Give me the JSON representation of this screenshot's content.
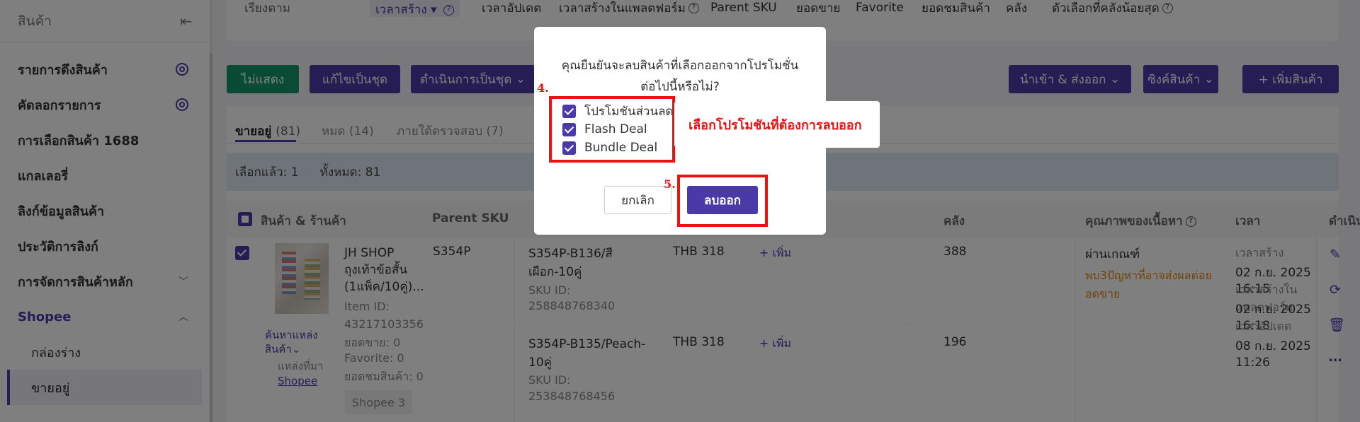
{
  "sidebar": {
    "title": "สินค้า",
    "items": [
      {
        "label": "รายการดึงสินค้า",
        "icon": "gear-icon"
      },
      {
        "label": "คัดลอกรายการ",
        "icon": "gear-icon"
      },
      {
        "label": "การเลือกสินค้า 1688"
      },
      {
        "label": "แกลเลอรี่"
      },
      {
        "label": "ลิงก์ข้อมูลสินค้า"
      },
      {
        "label": "ประวัติการลิงก์"
      },
      {
        "label": "การจัดการสินค้าหลัก",
        "icon": "chevron-down-icon"
      },
      {
        "label": "Shopee",
        "icon": "chevron-up-icon"
      }
    ],
    "subitems": [
      {
        "label": "กล่องร่าง"
      },
      {
        "label": "ขายอยู่"
      }
    ]
  },
  "filter": {
    "label": "เรียงตาม",
    "sort_options": [
      "เวลาสร้าง",
      "เวลาอัปเดต",
      "เวลาสร้างในแพลตฟอร์ม",
      "Parent SKU",
      "ยอดขาย",
      "Favorite",
      "ยอดชมสินค้า",
      "คลัง",
      "ตัวเลือกที่คลังน้อยสุด"
    ]
  },
  "toolbar": {
    "hide": "ไม่แสดง",
    "bulk_edit": "แก้ไขเป็นชุด",
    "bulk_action": "ดำเนินการเป็นชุด",
    "import_export": "นำเข้า & ส่งออก",
    "sync": "ซิงค์สินค้า",
    "add": "+ เพิ่มสินค้า"
  },
  "tabs": [
    {
      "label": "ขายอยู่",
      "count": "(81)"
    },
    {
      "label": "หมด",
      "count": "(14)"
    },
    {
      "label": "ภายใต้ตรวจสอบ",
      "count": "(7)"
    }
  ],
  "selection": {
    "selected": "เลือกแล้ว: 1",
    "total": "ทั้งหมด: 81"
  },
  "table": {
    "headers": [
      "สินค้า & ร้านค้า",
      "Parent SKU",
      "คลัง",
      "คุณภาพของเนื้อหา",
      "เวลา",
      "ดำเนิน"
    ],
    "product": {
      "shop": "JH SHOP",
      "name_line1": "ถุงเท้าข้อสั้น",
      "name_line2": "(1แพ็ค/10คู่)...",
      "item_id_label": "Item ID:",
      "item_id": "43217103356",
      "sales": "ยอดขาย: 0",
      "favorite": "Favorite: 0",
      "views": "ยอดชมสินค้า: 0",
      "find_source": "ค้นหาแหล่ง",
      "find_source2": "สินค้า",
      "source_label": "แหล่งที่มา",
      "source_link": "Shopee",
      "tag": "Shopee 3",
      "parent_sku": "S354P",
      "quality": "ผ่านเกณฑ์",
      "quality_warn1": "พบ3ปัญหาที่อาจส่งผลต่อย",
      "quality_warn2": "อดขาย",
      "time_created_label": "เวลาสร้าง",
      "time_created": "02 ก.ย. 2025 16:15",
      "time_platform_label": "เวลาสร้างในแพลตฟอร์ม",
      "time_platform": "02 ก.ย. 2025 16:18",
      "time_updated_label": "เวลาอัปเดต",
      "time_updated": "08 ก.ย. 2025 11:26"
    },
    "variants": [
      {
        "sku_line1": "S354P-B136/สี",
        "sku_line2": "เผือก-10คู่",
        "sku_id_label": "SKU ID:",
        "sku_id": "258848768340",
        "price": "THB 318",
        "add": "+ เพิ่ม",
        "stock": "388"
      },
      {
        "sku_line1": "S354P-B135/Peach-",
        "sku_line2": "10คู่",
        "sku_id_label": "SKU ID:",
        "sku_id": "253848768456",
        "price": "THB 318",
        "add": "+ เพิ่ม",
        "stock": "196"
      }
    ]
  },
  "modal": {
    "message_line1": "คุณยืนยันจะลบสินค้าที่เลือกออกจากโปรโมชั่น",
    "message_line2": "ต่อไปนี้หรือไม่?",
    "options": [
      "โปรโมชันส่วนลด",
      "Flash Deal",
      "Bundle Deal"
    ],
    "cancel": "ยกเลิก",
    "delete": "ลบออก"
  },
  "annotations": {
    "step4": "4.",
    "step5": "5.",
    "callout": "เลือกโปรโมชันที่ต้องการลบออก",
    "color": "#ee1111"
  },
  "colors": {
    "accent": "#4a3aa8",
    "green": "#14976a",
    "warning": "#e6890e"
  }
}
